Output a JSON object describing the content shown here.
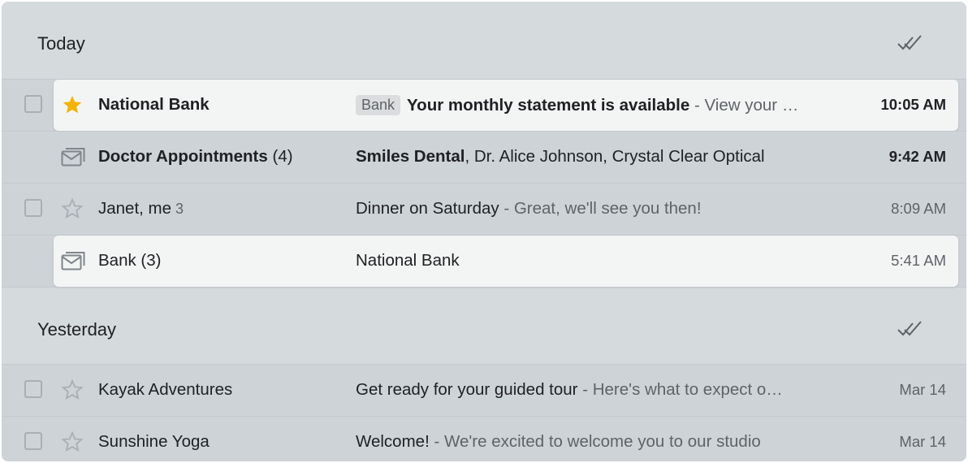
{
  "sections": [
    {
      "title": "Today",
      "rows": [
        {
          "sender": "National Bank",
          "count": "",
          "label": "Bank",
          "subject": "Your monthly statement is available",
          "snippet": " - View your …",
          "time": "10:05 AM"
        },
        {
          "sender": "Doctor Appointments",
          "count": " (4)",
          "subject": "Smiles Dental",
          "snippet": ", Dr. Alice Johnson, Crystal Clear Optical",
          "time": "9:42 AM"
        },
        {
          "sender": "Janet, me",
          "count": " 3",
          "subject": "Dinner on Saturday",
          "snippet": " - Great, we'll see you then!",
          "time": "8:09 AM"
        },
        {
          "sender": "Bank (3)",
          "count": "",
          "subject": "National Bank",
          "snippet": "",
          "time": "5:41 AM"
        }
      ]
    },
    {
      "title": "Yesterday",
      "rows": [
        {
          "sender": "Kayak Adventures",
          "count": "",
          "subject": "Get ready for your guided tour",
          "snippet": " - Here's what to expect o…",
          "time": "Mar 14"
        },
        {
          "sender": "Sunshine Yoga",
          "count": "",
          "subject": "Welcome!",
          "snippet": " - We're excited to welcome you to our studio",
          "time": "Mar 14"
        }
      ]
    }
  ],
  "icons": {
    "mark_done": "double-check-icon",
    "star_filled": "star-filled-icon",
    "star_empty": "star-outline-icon",
    "bundle": "envelope-stack-icon"
  },
  "colors": {
    "star": "#f4b400",
    "panel": "#d5dadd",
    "highlight": "#f3f4f4"
  }
}
